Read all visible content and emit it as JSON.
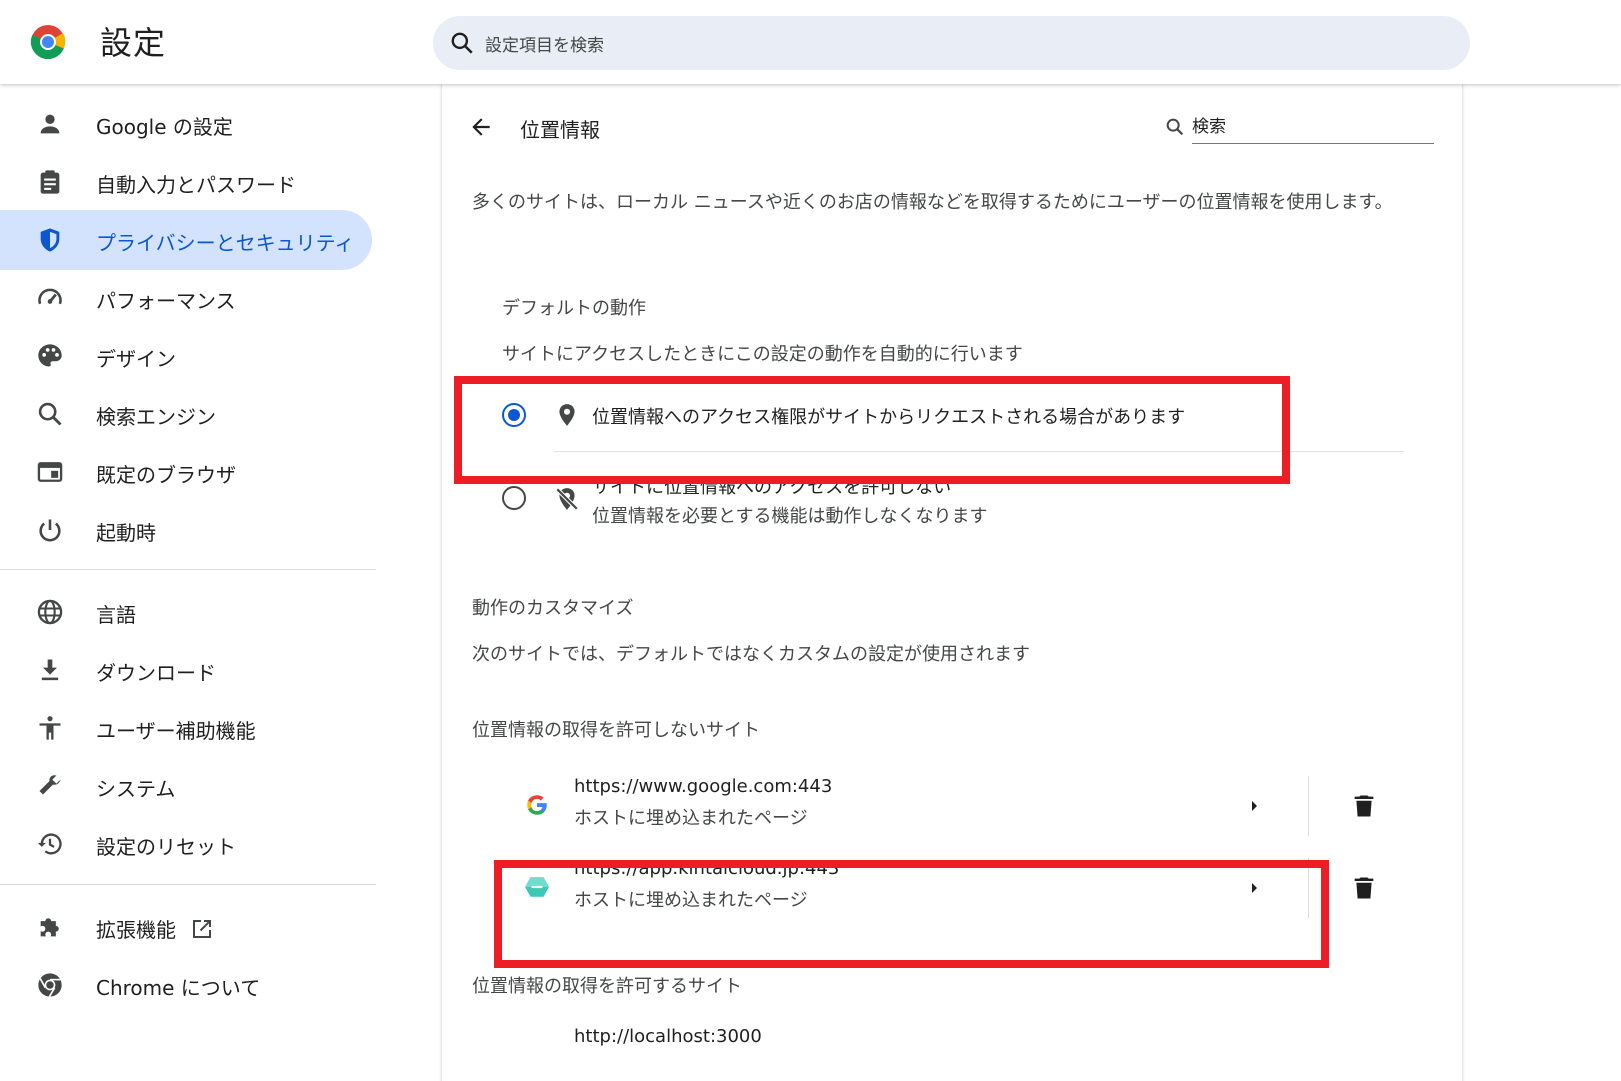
{
  "header": {
    "title": "設定",
    "search_placeholder": "設定項目を検索"
  },
  "sidebar": {
    "items": [
      {
        "label": "Google の設定",
        "icon": "person-icon"
      },
      {
        "label": "自動入力とパスワード",
        "icon": "clipboard-icon"
      },
      {
        "label": "プライバシーとセキュリティ",
        "icon": "shield-icon",
        "active": true
      },
      {
        "label": "パフォーマンス",
        "icon": "speedometer-icon"
      },
      {
        "label": "デザイン",
        "icon": "palette-icon"
      },
      {
        "label": "検索エンジン",
        "icon": "search-icon"
      },
      {
        "label": "既定のブラウザ",
        "icon": "browser-icon"
      },
      {
        "label": "起動時",
        "icon": "power-icon"
      },
      {
        "label": "言語",
        "icon": "globe-icon"
      },
      {
        "label": "ダウンロード",
        "icon": "download-icon"
      },
      {
        "label": "ユーザー補助機能",
        "icon": "accessibility-icon"
      },
      {
        "label": "システム",
        "icon": "wrench-icon"
      },
      {
        "label": "設定のリセット",
        "icon": "history-icon"
      },
      {
        "label": "拡張機能",
        "icon": "puzzle-icon"
      },
      {
        "label": "Chrome について",
        "icon": "chrome-icon"
      }
    ]
  },
  "page": {
    "title": "位置情報",
    "search_placeholder": "検索",
    "description": "多くのサイトは、ローカル ニュースや近くのお店の情報などを取得するためにユーザーの位置情報を使用します。",
    "default_behavior": {
      "heading": "デフォルトの動作",
      "subheading": "サイトにアクセスしたときにこの設定の動作を自動的に行います",
      "options": [
        {
          "label": "位置情報へのアクセス権限がサイトからリクエストされる場合があります",
          "selected": true
        },
        {
          "label": "サイトに位置情報へのアクセスを許可しない",
          "sublabel": "位置情報を必要とする機能は動作しなくなります",
          "selected": false
        }
      ]
    },
    "custom": {
      "heading": "動作のカスタマイズ",
      "subheading": "次のサイトでは、デフォルトではなくカスタムの設定が使用されます"
    },
    "blocked": {
      "heading": "位置情報の取得を許可しないサイト",
      "sites": [
        {
          "url": "https://www.google.com:443",
          "desc": "ホストに埋め込まれたページ"
        },
        {
          "url": "https://app.kintaicloud.jp:443",
          "desc": "ホストに埋め込まれたページ"
        }
      ]
    },
    "allowed": {
      "heading": "位置情報の取得を許可するサイト",
      "sites": [
        {
          "url": "http://localhost:3000"
        }
      ]
    }
  },
  "colors": {
    "accent": "#0b57d0",
    "active_nav_bg": "#d3e3fd",
    "highlight": "#ee1c25"
  }
}
